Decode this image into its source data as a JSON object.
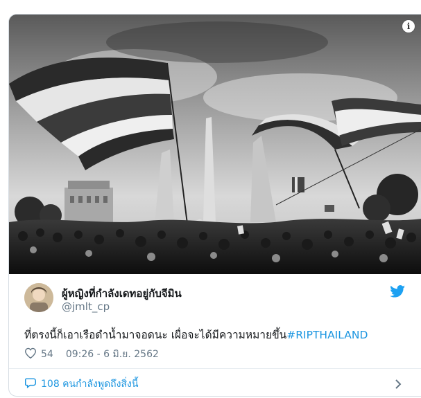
{
  "tweet": {
    "display_name": "ผู้หญิงที่กำลังเดทอยู่กับจีมิน",
    "handle": "@jmlt_cp",
    "text_main": "ที่ตรงนี้ก็เอาเรือดำน้ำมาจอดนะ เผื่อจะได้มีความหมายขึ้น",
    "hashtag": "#RIPTHAILAND",
    "likes": "54",
    "timestamp": "09:26 - 6 มิ.ย. 2562",
    "replies_text": "108 คนกำลังพูดถึงสิ่งนี้"
  },
  "icons": {
    "info": "info-icon",
    "bird": "twitter-bird-icon",
    "heart": "heart-icon",
    "reply": "chat-bubble-icon",
    "chevron": "chevron-right-icon"
  },
  "colors": {
    "accent": "#1b95e0",
    "text": "#14171a",
    "muted": "#657786"
  }
}
